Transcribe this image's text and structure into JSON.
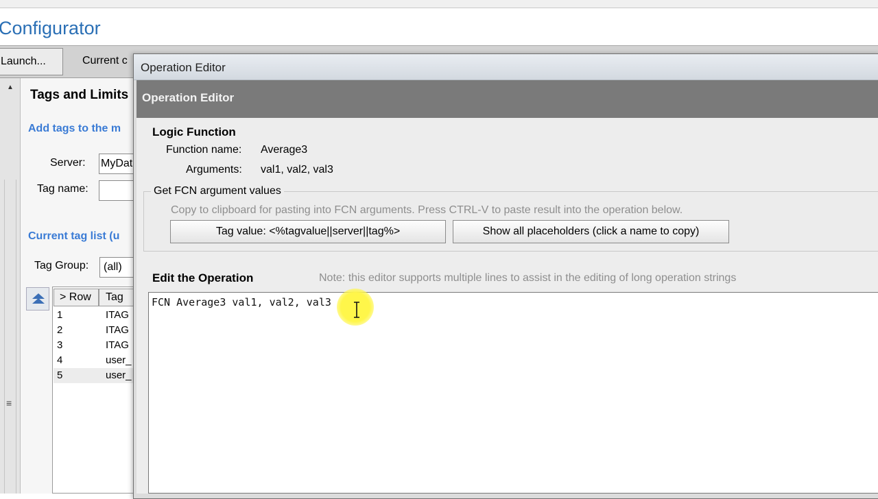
{
  "app": {
    "title": "Configurator",
    "launch_button": "Launch...",
    "current_tab": "Current c"
  },
  "left_panel": {
    "section_title": "Tags and Limits",
    "add_tags_heading": "Add tags to the m",
    "server_label": "Server:",
    "server_value": "MyData",
    "tag_name_label": "Tag name:",
    "tag_name_value": "",
    "current_list_heading": "Current tag list (u",
    "tag_group_label": "Tag Group:",
    "tag_group_value": "(all)",
    "table": {
      "columns": [
        "> Row",
        "Tag"
      ],
      "rows": [
        {
          "row": "1",
          "tag": "ITAG"
        },
        {
          "row": "2",
          "tag": "ITAG"
        },
        {
          "row": "3",
          "tag": "ITAG"
        },
        {
          "row": "4",
          "tag": "user_"
        },
        {
          "row": "5",
          "tag": "user_"
        }
      ]
    }
  },
  "dialog": {
    "window_title": "Operation Editor",
    "header_title": "Operation Editor",
    "logic_function": {
      "title": "Logic Function",
      "function_name_label": "Function name:",
      "function_name_value": "Average3",
      "arguments_label": "Arguments:",
      "arguments_value": "val1, val2, val3"
    },
    "fcn_args": {
      "title": "Get FCN argument values",
      "hint": "Copy to clipboard for pasting into FCN arguments. Press CTRL-V to paste result into the operation below.",
      "tag_value_button": "Tag value: <%tagvalue||server||tag%>",
      "show_placeholders_button": "Show all placeholders (click a name to copy)"
    },
    "edit": {
      "title": "Edit the Operation",
      "note": "Note: this editor supports multiple lines to assist in the editing of long operation strings",
      "operation_text": "FCN Average3 val1, val2, val3"
    }
  },
  "colors": {
    "accent_blue": "#3a7bd5",
    "title_blue": "#2a6fb5",
    "dialog_header": "#7a7a7a",
    "cursor_highlight": "#fff64a"
  },
  "icons": {
    "scroll_up": "triangle-up-icon",
    "sort_up": "double-chevron-up-icon",
    "grip": "grip-lines-icon",
    "text_cursor": "i-beam-cursor-icon"
  }
}
